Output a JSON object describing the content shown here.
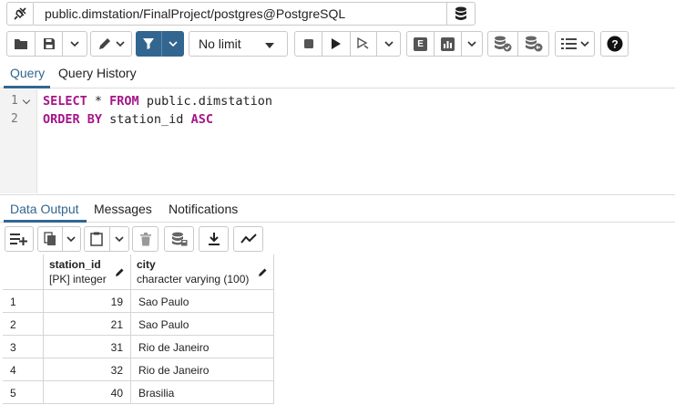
{
  "connection": {
    "label": "public.dimstation/FinalProject/postgres@PostgreSQL"
  },
  "toolbar": {
    "limit_selected": "No limit",
    "explain_label": "E"
  },
  "query_tabs": [
    "Query",
    "Query History"
  ],
  "editor": {
    "lines": [
      {
        "num": "1",
        "tokens": [
          {
            "t": "SELECT",
            "kw": true
          },
          {
            "t": " * ",
            "kw": false
          },
          {
            "t": "FROM",
            "kw": true
          },
          {
            "t": " public.dimstation",
            "kw": false
          }
        ]
      },
      {
        "num": "2",
        "tokens": [
          {
            "t": "ORDER BY",
            "kw": true
          },
          {
            "t": " station_id ",
            "kw": false
          },
          {
            "t": "ASC",
            "kw": true
          }
        ]
      }
    ]
  },
  "output_tabs": [
    "Data Output",
    "Messages",
    "Notifications"
  ],
  "grid": {
    "columns": [
      {
        "name": "station_id",
        "type": "[PK] integer"
      },
      {
        "name": "city",
        "type": "character varying (100)"
      }
    ],
    "rows": [
      {
        "num": "1",
        "station_id": "19",
        "city": "Sao Paulo"
      },
      {
        "num": "2",
        "station_id": "21",
        "city": "Sao Paulo"
      },
      {
        "num": "3",
        "station_id": "31",
        "city": "Rio de Janeiro"
      },
      {
        "num": "4",
        "station_id": "32",
        "city": "Rio de Janeiro"
      },
      {
        "num": "5",
        "station_id": "40",
        "city": "Brasilia"
      }
    ]
  },
  "colors": {
    "accent": "#326690",
    "keyword": "#a6158a"
  }
}
